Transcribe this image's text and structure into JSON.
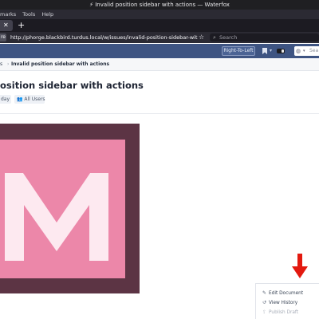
{
  "window": {
    "title": "⚡ Invalid position sidebar with actions — Waterfox"
  },
  "menubar": {
    "items": [
      "marks",
      "Tools",
      "Help"
    ]
  },
  "tabs": {
    "close_glyph": "✕",
    "new_tab_glyph": "+"
  },
  "navbar": {
    "site_badge": "re",
    "url": "http://phorge.blackbird.turdus.local/w/issues/invalid-position-sidebar-with-actions/",
    "search_placeholder": "Search"
  },
  "appbar": {
    "rtl_label": "Right-To-Left",
    "search_placeholder": "Sea",
    "color": "#3e5482"
  },
  "breadcrumb": {
    "first": "s",
    "separator": "›",
    "current": "Invalid position sidebar with actions"
  },
  "page": {
    "title": "osition sidebar with actions",
    "date_tag": "day",
    "visibility_tag": "All Users"
  },
  "hero": {
    "letter": "M",
    "outer_color": "#5c3444",
    "inner_color": "#ec87a9"
  },
  "actions": [
    {
      "icon": "pencil-icon",
      "label": "Edit Document",
      "enabled": true
    },
    {
      "icon": "history-icon",
      "label": "View History",
      "enabled": true
    },
    {
      "icon": "upload-icon",
      "label": "Publish Draft",
      "enabled": false
    }
  ]
}
